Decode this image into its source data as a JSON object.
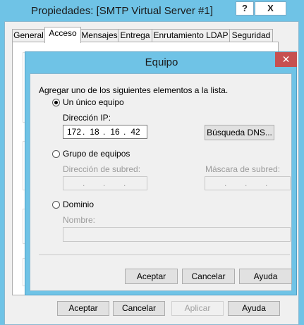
{
  "back_window": {
    "title": "Propiedades: [SMTP Virtual Server #1]",
    "help_button": "?",
    "close_button": "X",
    "tabs": [
      "General",
      "Acceso",
      "Mensajes",
      "Entrega",
      "Enrutamiento LDAP",
      "Seguridad"
    ],
    "active_tab": "Acceso",
    "panel_glyph": "ic",
    "buttons": {
      "accept": "Aceptar",
      "cancel": "Cancelar",
      "apply": "Aplicar",
      "help": "Ayuda"
    }
  },
  "dialog": {
    "title": "Equipo",
    "close_button": "✕",
    "instruction": "Agregar uno de los siguientes elementos a la lista.",
    "single_computer": {
      "radio_label": "Un único equipo",
      "checked": true,
      "ip_label": "Dirección IP:",
      "ip_octets": [
        "172",
        "18",
        "16",
        "42"
      ],
      "dns_button": "Búsqueda DNS..."
    },
    "group": {
      "radio_label": "Grupo de equipos",
      "checked": false,
      "subnet_label": "Dirección de subred:",
      "mask_label": "Máscara de subred:"
    },
    "domain": {
      "radio_label": "Dominio",
      "checked": false,
      "name_label": "Nombre:"
    },
    "buttons": {
      "accept": "Aceptar",
      "cancel": "Cancelar",
      "help": "Ayuda"
    }
  }
}
